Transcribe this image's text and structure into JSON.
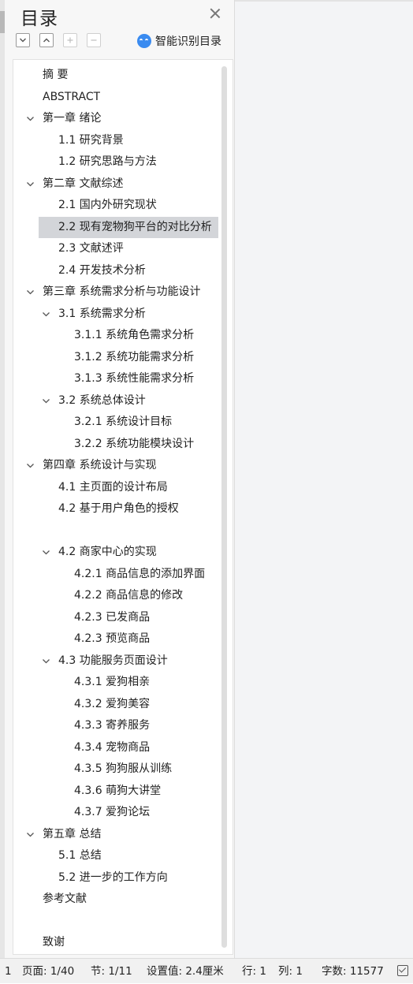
{
  "panel": {
    "title": "目录",
    "smart_toc_label": "智能识别目录"
  },
  "toc": [
    {
      "text": "摘  要",
      "level": 1,
      "expandable": false
    },
    {
      "text": "ABSTRACT",
      "level": 1,
      "expandable": false
    },
    {
      "text": "第一章  绪论",
      "level": 1,
      "expandable": true
    },
    {
      "text": "1.1 研究背景",
      "level": 2,
      "expandable": false
    },
    {
      "text": "1.2 研究思路与方法",
      "level": 2,
      "expandable": false
    },
    {
      "text": "第二章  文献综述",
      "level": 1,
      "expandable": true
    },
    {
      "text": "2.1 国内外研究现状",
      "level": 2,
      "expandable": false
    },
    {
      "text": "2.2 现有宠物狗平台的对比分析",
      "level": 2,
      "expandable": false,
      "selected": true
    },
    {
      "text": "2.3  文献述评",
      "level": 2,
      "expandable": false
    },
    {
      "text": "2.4  开发技术分析",
      "level": 2,
      "expandable": false
    },
    {
      "text": "第三章  系统需求分析与功能设计",
      "level": 1,
      "expandable": true
    },
    {
      "text": "3.1 系统需求分析",
      "level": 2,
      "expandable": true
    },
    {
      "text": "3.1.1  系统角色需求分析",
      "level": 3,
      "expandable": false
    },
    {
      "text": "3.1.2  系统功能需求分析",
      "level": 3,
      "expandable": false
    },
    {
      "text": "3.1.3  系统性能需求分析",
      "level": 3,
      "expandable": false
    },
    {
      "text": "3.2  系统总体设计",
      "level": 2,
      "expandable": true
    },
    {
      "text": "3.2.1  系统设计目标",
      "level": 3,
      "expandable": false
    },
    {
      "text": "3.2.2  系统功能模块设计",
      "level": 3,
      "expandable": false
    },
    {
      "text": "第四章  系统设计与实现",
      "level": 1,
      "expandable": true
    },
    {
      "text": "4.1 主页面的设计布局",
      "level": 2,
      "expandable": false
    },
    {
      "text": "4.2 基于用户角色的授权",
      "level": 2,
      "expandable": false
    },
    {
      "text": "",
      "level": 2,
      "expandable": false
    },
    {
      "text": "4.2  商家中心的实现",
      "level": 2,
      "expandable": true
    },
    {
      "text": "4.2.1  商品信息的添加界面",
      "level": 3,
      "expandable": false
    },
    {
      "text": "4.2.2  商品信息的修改",
      "level": 3,
      "expandable": false
    },
    {
      "text": "4.2.3 已发商品",
      "level": 3,
      "expandable": false
    },
    {
      "text": "4.2.3  预览商品",
      "level": 3,
      "expandable": false
    },
    {
      "text": "4.3  功能服务页面设计",
      "level": 2,
      "expandable": true
    },
    {
      "text": "4.3.1 爱狗相亲",
      "level": 3,
      "expandable": false
    },
    {
      "text": "4.3.2 爱狗美容",
      "level": 3,
      "expandable": false
    },
    {
      "text": "4.3.3 寄养服务",
      "level": 3,
      "expandable": false
    },
    {
      "text": "4.3.4  宠物商品",
      "level": 3,
      "expandable": false
    },
    {
      "text": "4.3.5  狗狗服从训练",
      "level": 3,
      "expandable": false
    },
    {
      "text": "4.3.6  萌狗大讲堂",
      "level": 3,
      "expandable": false
    },
    {
      "text": "4.3.7 爱狗论坛",
      "level": 3,
      "expandable": false
    },
    {
      "text": "第五章  总结",
      "level": 1,
      "expandable": true
    },
    {
      "text": "5.1  总结",
      "level": 2,
      "expandable": false
    },
    {
      "text": "5.2  进一步的工作方向",
      "level": 2,
      "expandable": false
    },
    {
      "text": "参考文献",
      "level": 1,
      "expandable": false
    },
    {
      "text": "",
      "level": 1,
      "expandable": false
    },
    {
      "text": "致谢",
      "level": 1,
      "expandable": false
    }
  ],
  "status_bar": {
    "page_num_short": "1",
    "page": "页面: 1/40",
    "section": "节: 1/11",
    "setting": "设置值: 2.4厘米",
    "row": "行: 1",
    "col": "列: 1",
    "word_count": "字数: 11577"
  },
  "icons": {
    "collapse_all": "collapse-all-icon",
    "expand_all": "expand-all-icon",
    "add": "plus-icon",
    "remove": "minus-icon",
    "smart": "ai-face-icon",
    "close": "close-icon",
    "spell_check": "check-icon"
  },
  "colors": {
    "selected_row": "#d3d5d9",
    "ai_icon": "#3a8bf0"
  }
}
